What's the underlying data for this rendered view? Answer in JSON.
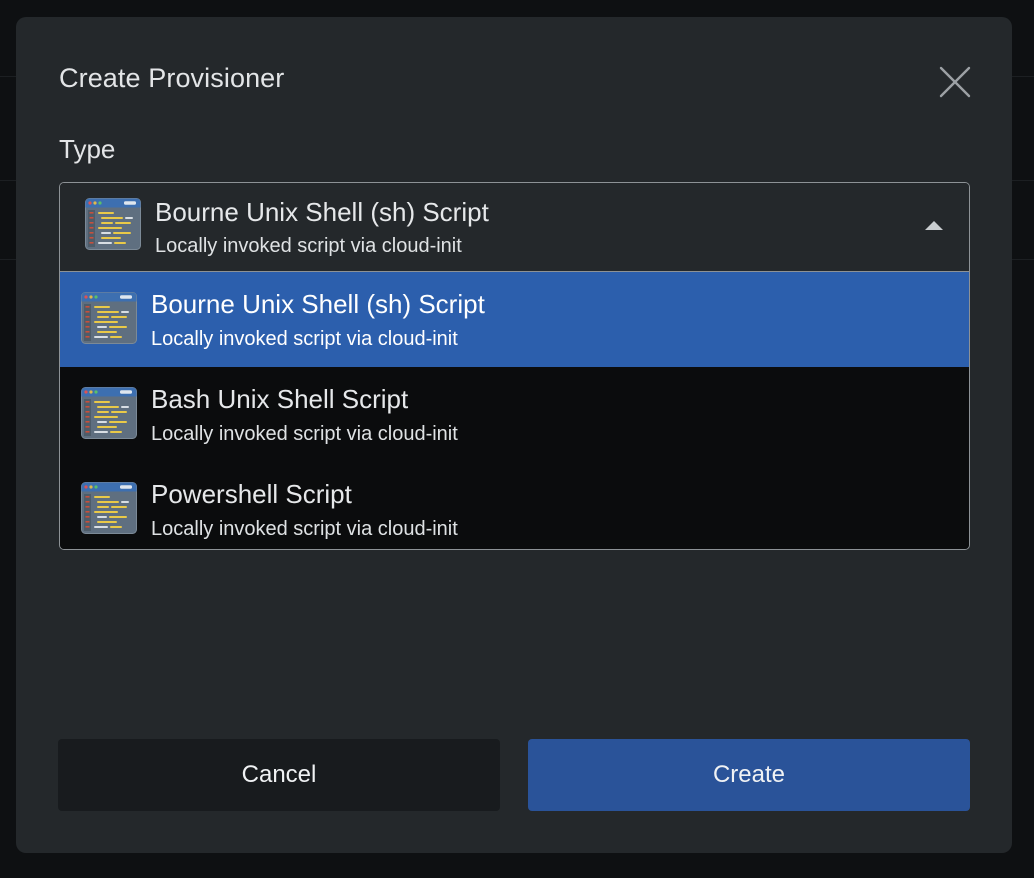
{
  "dialog": {
    "title": "Create Provisioner",
    "close_icon": "close-icon"
  },
  "type_field": {
    "label": "Type",
    "selected": {
      "title": "Bourne Unix Shell (sh) Script",
      "subtitle": "Locally invoked script via cloud-init",
      "icon": "script-editor-icon"
    },
    "expanded": true,
    "options": [
      {
        "title": "Bourne Unix Shell (sh) Script",
        "subtitle": "Locally invoked script via cloud-init",
        "icon": "script-editor-icon",
        "selected": true
      },
      {
        "title": "Bash Unix Shell Script",
        "subtitle": "Locally invoked script via cloud-init",
        "icon": "script-editor-icon",
        "selected": false
      },
      {
        "title": "Powershell Script",
        "subtitle": "Locally invoked script via cloud-init",
        "icon": "script-editor-icon",
        "selected": false
      }
    ]
  },
  "actions": {
    "cancel_label": "Cancel",
    "create_label": "Create"
  },
  "colors": {
    "modal_bg": "#24282b",
    "selected_option_bg": "#2c5fad",
    "primary_button_bg": "#2a5399",
    "secondary_button_bg": "#181b1e",
    "option_list_bg": "#0b0c0d"
  }
}
